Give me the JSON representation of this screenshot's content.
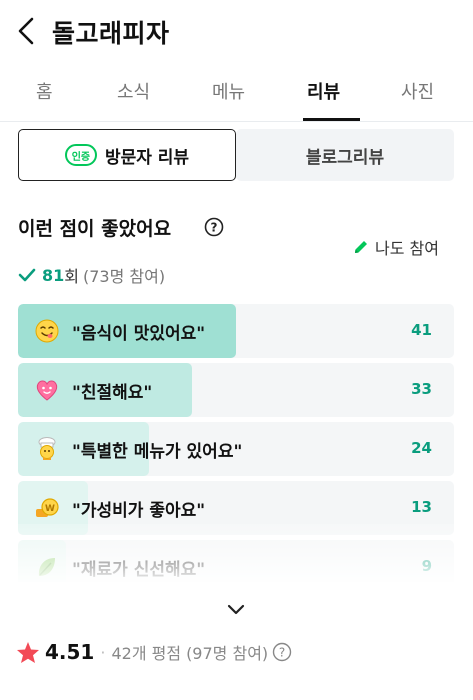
{
  "header": {
    "title": "돌고래피자"
  },
  "tabs": [
    "홈",
    "소식",
    "메뉴",
    "리뷰",
    "사진"
  ],
  "active_tab": "리뷰",
  "segment": {
    "visitor_label": "방문자 리뷰",
    "verify_badge": "인증",
    "blog_label": "블로그리뷰"
  },
  "keywords": {
    "title": "이런 점이 좋았어요",
    "me_too": "나도 참여",
    "count": "81",
    "count_unit": "회",
    "participants": "(73명 참여)"
  },
  "review_items": [
    {
      "label": "\"음식이 맛있어요\"",
      "count": "41",
      "fraction": 0.5,
      "fill_color": "#9fe0d3",
      "emoji": "yum-face-icon"
    },
    {
      "label": "\"친절해요\"",
      "count": "33",
      "fraction": 0.4,
      "fill_color": "#bfeae2",
      "emoji": "heart-face-icon"
    },
    {
      "label": "\"특별한 메뉴가 있어요\"",
      "count": "24",
      "fraction": 0.3,
      "fill_color": "#d5f1ec",
      "emoji": "chef-icon"
    },
    {
      "label": "\"가성비가 좋아요\"",
      "count": "13",
      "fraction": 0.16,
      "fill_color": "#e2f5f1",
      "emoji": "coin-icon"
    },
    {
      "label": "\"재료가 신선해요\"",
      "count": "9",
      "fraction": 0.11,
      "fill_color": "#e8f6f2",
      "emoji": "leaf-icon"
    }
  ],
  "rating": {
    "score": "4.51",
    "review_count": "42개 평점",
    "participants": "(97명 참여)"
  },
  "colors": {
    "accent": "#0a9d7e",
    "green": "#03c75a",
    "star": "#f24a56"
  }
}
